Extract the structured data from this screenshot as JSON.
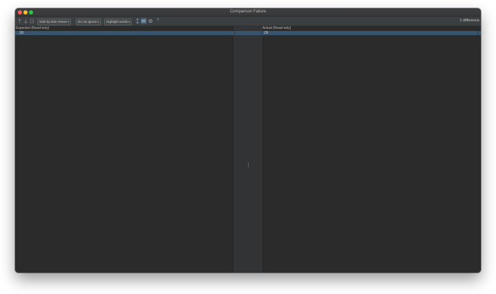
{
  "window": {
    "title": "Comparison Failure"
  },
  "toolbar": {
    "icons": [
      "prev-difference-icon",
      "next-difference-icon",
      "jump-to-source-icon",
      "sync-scroll-icon",
      "collapse-unchanged-icon",
      "settings-icon",
      "help-icon"
    ],
    "help_label": "?",
    "viewer_label": "Side-by-side viewer",
    "ignore_label": "Do not ignore",
    "highlight_label": "Highlight words",
    "difference_count": "1 difference"
  },
  "left_pane": {
    "header": "Expected (Read-only)",
    "line": "28"
  },
  "right_pane": {
    "header": "Actual (Read-only)",
    "line": "29"
  },
  "colors": {
    "editor_bg": "#2b2b2b",
    "toolbar_bg": "#3c3f41",
    "gutter_bg": "#313335",
    "changed_line": "#385570"
  }
}
